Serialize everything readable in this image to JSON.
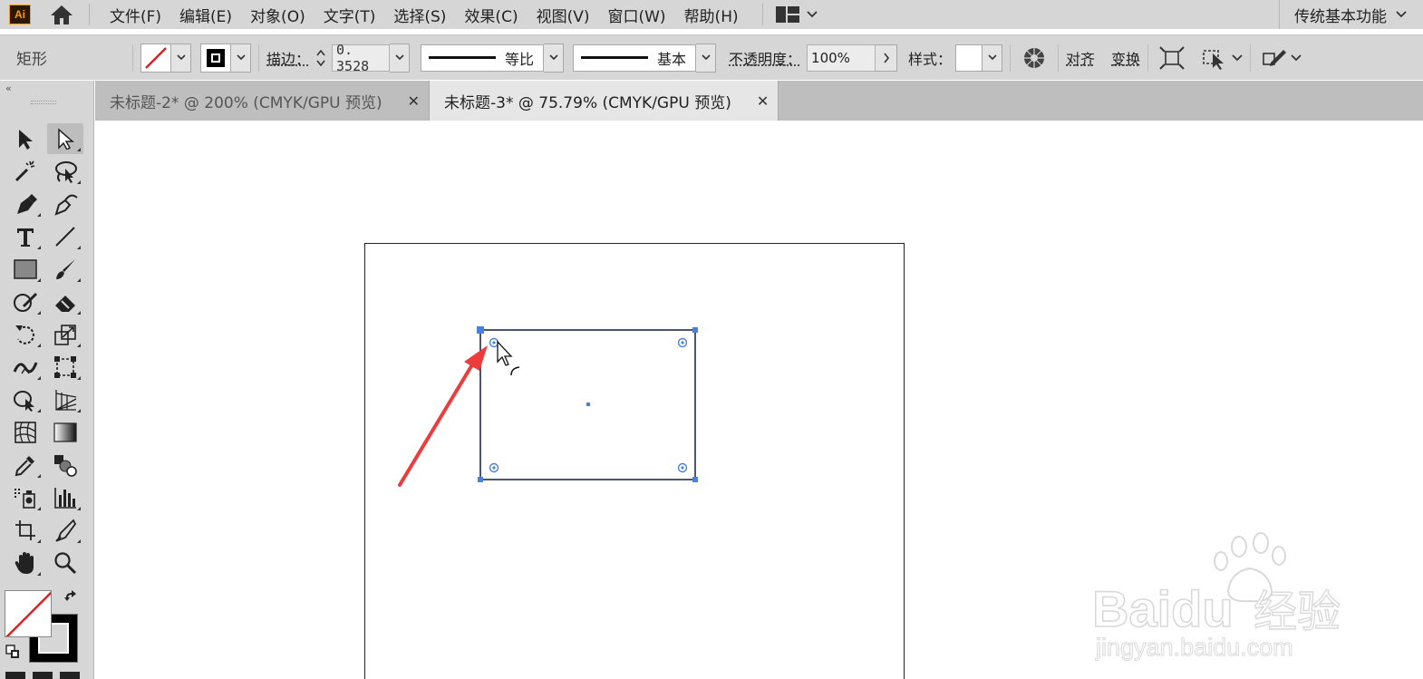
{
  "app": {
    "logo": "Ai"
  },
  "menu": {
    "items": [
      {
        "label": "文件(F)"
      },
      {
        "label": "编辑(E)"
      },
      {
        "label": "对象(O)"
      },
      {
        "label": "文字(T)"
      },
      {
        "label": "选择(S)"
      },
      {
        "label": "效果(C)"
      },
      {
        "label": "视图(V)"
      },
      {
        "label": "窗口(W)"
      },
      {
        "label": "帮助(H)"
      }
    ],
    "workspace": "传统基本功能"
  },
  "control": {
    "object_type": "矩形",
    "stroke_label": "描边：",
    "stroke_weight": "0. 3528",
    "profile_label": "等比",
    "brush_label": "基本",
    "opacity_label": "不透明度：",
    "opacity_value": "100%",
    "style_label": "样式：",
    "align_label": "对齐",
    "transform_label": "变换"
  },
  "tabs": [
    {
      "title": "未标题-2* @ 200% (CMYK/GPU 预览)",
      "active": false
    },
    {
      "title": "未标题-3* @ 75.79% (CMYK/GPU 预览)",
      "active": true
    }
  ],
  "colors": {
    "selection": "#4a7fe0",
    "arrow": "#ee3b3b",
    "stroke_none": "#e02020"
  },
  "watermark": {
    "brand": "Baidu",
    "brand_cn": "经验",
    "url": "jingyan.baidu.com"
  }
}
